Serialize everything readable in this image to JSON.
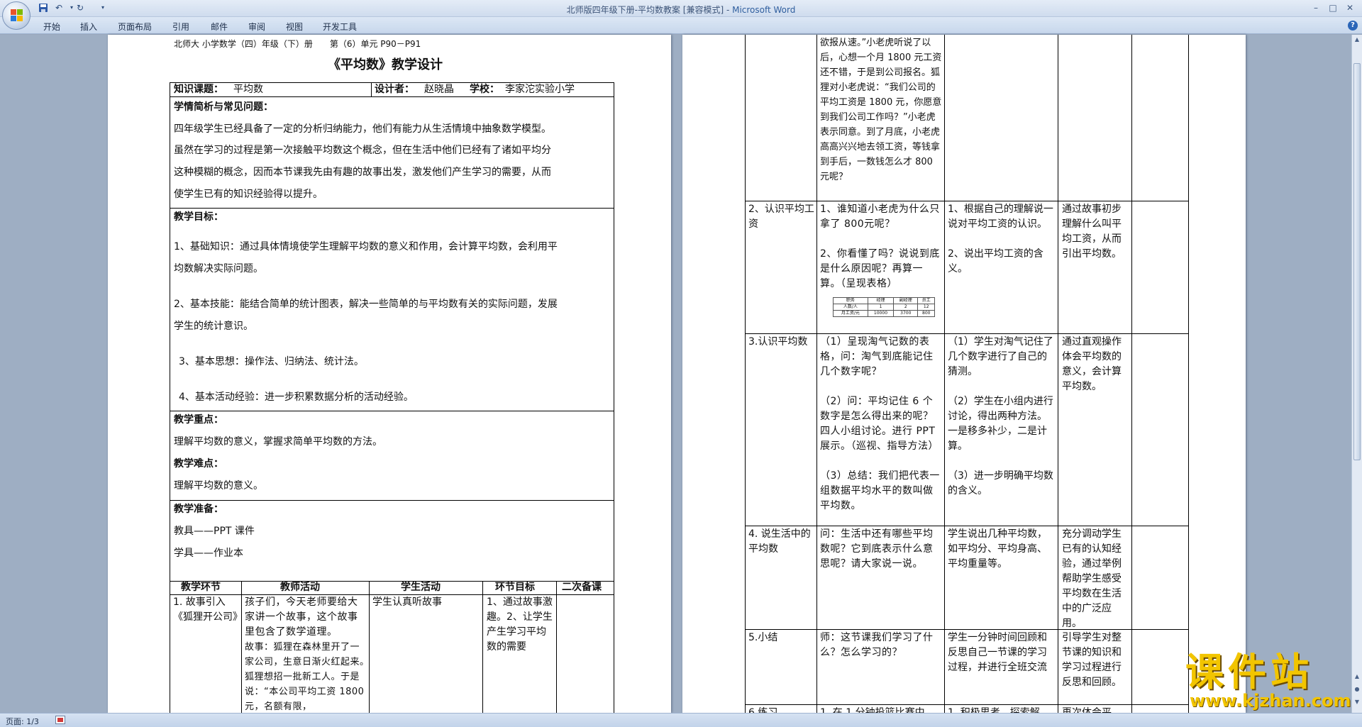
{
  "window": {
    "doc_name": "北师版四年级下册-平均数教案 [兼容模式] - ",
    "app_name": "Microsoft Word",
    "controls": [
      "–",
      "□",
      "✕"
    ]
  },
  "quick_access": {
    "save_icon": "save-icon",
    "undo_icon": "undo-icon",
    "redo_icon": "redo-icon",
    "customize_icon": "customize-qat-icon"
  },
  "ribbon_tabs": [
    "开始",
    "插入",
    "页面布局",
    "引用",
    "邮件",
    "审阅",
    "视图",
    "开发工具"
  ],
  "status": {
    "page": "页面: 1/3"
  },
  "watermark": {
    "title": "课件站",
    "url": "www.kjzhan.com"
  },
  "page1": {
    "header": "北师大 小学数学（四）年级（下）册　　第（6）单元 P90－P91",
    "title": "《平均数》教学设计",
    "row_topic": {
      "topic_label": "知识课题：",
      "topic_value": "平均数",
      "designer_label": "设计者：",
      "designer_value": "赵晓晶",
      "school_label": "学校：",
      "school_value": "李家沱实验小学"
    },
    "analysis": {
      "heading": "学情简析与常见问题：",
      "lines": [
        "四年级学生已经具备了一定的分析归纳能力，他们有能力从生活情境中抽象数学模型。",
        "虽然在学习的过程是第一次接触平均数这个概念，但在生活中他们已经有了诸如平均分",
        "这种模糊的概念，因而本节课我先由有趣的故事出发，激发他们产生学习的需要，从而",
        "使学生已有的知识经验得以提升。"
      ]
    },
    "goals": {
      "heading": "教学目标：",
      "g1a": "1、基础知识：通过具体情境使学生理解平均数的意义和作用，会计算平均数，会利用平",
      "g1b": "均数解决实际问题。",
      "g2a": "2、基本技能：能结合简单的统计图表，解决一些简单的与平均数有关的实际问题，发展",
      "g2b": "学生的统计意识。",
      "g3": "3、基本思想：操作法、归纳法、统计法。",
      "g4": "4、基本活动经验：进一步积累数据分析的活动经验。"
    },
    "key": {
      "heading": "教学重点：",
      "text": "理解平均数的意义，掌握求简单平均数的方法。",
      "hard_heading": "教学难点：",
      "hard_text": "理解平均数的意义。"
    },
    "prep": {
      "heading": "教学准备：",
      "l1": "教具——PPT 课件",
      "l2": "学具——作业本"
    },
    "table_head": [
      "教学环节",
      "教师活动",
      "学生活动",
      "环节目标",
      "二次备课"
    ],
    "row1": {
      "stage": "1. 故事引入《狐狸开公司》",
      "teacher": "孩子们，今天老师要给大家讲一个故事，这个故事里包含了数学道理。",
      "teacher2": "故事：狐狸在森林里开了一家公司，生意日渐火红起来。　狐狸想招一批新工人。于是说：“本公司平均工资 1800 元，名额有限，",
      "student": "学生认真听故事",
      "goal": "1、通过故事激趣。2、让学生产生学习平均数的需要"
    }
  },
  "page2": {
    "story_cont": "欲报从速。”小老虎听说了以后，心想一个月 1800 元工资还不错，于是到公司报名。狐狸对小老虎说：“我们公司的平均工资是 1800 元，你愿意到我们公司工作吗？”小老虎表示同意。到了月底，小老虎高高兴兴地去领工资，等钱拿到手后，一数钱怎么才 800 元呢？",
    "row2": {
      "stage": "2、认识平均工资",
      "t1": "1、谁知道小老虎为什么只拿了 800元呢？",
      "t2": "2、你看懂了吗？说说到底是什么原因呢？再算一算。（呈现表格）",
      "s1": "1、根据自己的理解说一说对平均工资的认识。",
      "s2": "2、说出平均工资的含义。",
      "goal": "通过故事初步理解什么叫平均工资，从而引出平均数。",
      "salary_table": [
        [
          "职务",
          "经理",
          "副经理",
          "员工"
        ],
        [
          "人数/人",
          "1",
          "2",
          "12"
        ],
        [
          "月工资/元",
          "10000",
          "3700",
          "800"
        ]
      ]
    },
    "row3": {
      "stage": "3.认识平均数",
      "t1": "（1）呈现淘气记数的表格，问：淘气到底能记住几个数字呢？",
      "t2": "（2）问：平均记住 6 个数字是怎么得出来的呢？四人小组讨论。进行 PPT 展示。（巡视、指导方法）",
      "t3": "（3）总结：我们把代表一组数据平均水平的数叫做平均数。",
      "s1": "（1）学生对淘气记住了几个数字进行了自己的猜测。",
      "s2": "（2）学生在小组内进行讨论，得出两种方法。一是移多补少，二是计算。",
      "s3": "（3）进一步明确平均数的含义。",
      "goal": "通过直观操作体会平均数的意义，会计算平均数。"
    },
    "row4": {
      "stage": "4. 说生活中的平均数",
      "teacher": "问：生活中还有哪些平均数呢？它到底表示什么意思呢？请大家说一说。",
      "student": "学生说出几种平均数，如平均分、平均身高、平均重量等。",
      "goal": "充分调动学生已有的认知经验，通过举例帮助学生感受平均数在生活中的广泛应用。"
    },
    "row5": {
      "stage": "5.小结",
      "teacher": "师：这节课我们学习了什么？怎么学习的？",
      "student": "学生一分钟时间回顾和反思自己一节课的学习过程，并进行全班交流",
      "goal": "引导学生对整节课的知识和学习过程进行反思和回顾。"
    },
    "row6": {
      "stage": "6.练习",
      "teacher": "1. 在 1 分钟投篮比赛中",
      "student": "1. 积极思考，探索解",
      "goal": "再次体会平"
    }
  }
}
